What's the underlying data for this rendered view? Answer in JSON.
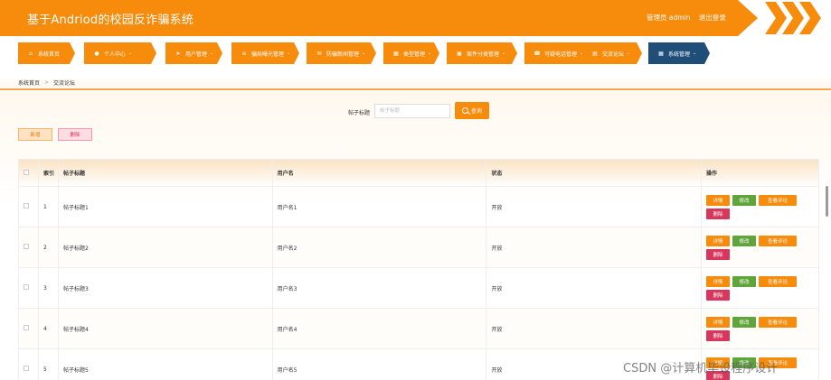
{
  "header": {
    "title": "基于Andriod的校园反诈骗系统",
    "role_label": "管理员 admin",
    "logout_label": "退出登录",
    "color": "#f78b0b"
  },
  "nav": {
    "items": [
      {
        "label": "系统首页",
        "icon": "home-icon",
        "glyph": "⌂",
        "caret": ""
      },
      {
        "label": "个人中心",
        "icon": "user-icon",
        "glyph": "●",
        "caret": "⌄"
      },
      {
        "label": "用户管理",
        "icon": "send-icon",
        "glyph": "➤",
        "caret": "⌄"
      },
      {
        "label": "骗局曝光管理",
        "icon": "document-icon",
        "glyph": "≡",
        "caret": "⌄"
      },
      {
        "label": "防骗新闻管理",
        "icon": "mail-icon",
        "glyph": "✉",
        "caret": "⌄"
      },
      {
        "label": "类型管理",
        "icon": "grid-icon",
        "glyph": "▦",
        "caret": "⌄"
      },
      {
        "label": "案件分类管理",
        "icon": "folder-icon",
        "glyph": "▣",
        "caret": "⌄"
      },
      {
        "label": "可疑电话管理",
        "icon": "comment-icon",
        "glyph": "☎",
        "caret": "⌄"
      },
      {
        "label": "交流论坛",
        "icon": "chat-icon",
        "glyph": "▤",
        "caret": "⌄"
      },
      {
        "label": "系统管理",
        "icon": "grid-icon",
        "glyph": "▦",
        "caret": "⌄"
      }
    ],
    "active_index": 9,
    "active_color": "#1f4e79"
  },
  "breadcrumb": {
    "home": "系统首页",
    "current": "交流论坛",
    "separator": ">"
  },
  "search": {
    "label": "帖子标题",
    "placeholder": "帖子标题",
    "value": "",
    "button_label": "查询"
  },
  "actions": {
    "add_label": "新增",
    "delete_label": "删除"
  },
  "table": {
    "headers": {
      "index": "索引",
      "title": "帖子标题",
      "username": "用户名",
      "status": "状态",
      "ops": "操作"
    },
    "rows": [
      {
        "index": "1",
        "title": "帖子标题1",
        "username": "用户名1",
        "status": "开放"
      },
      {
        "index": "2",
        "title": "帖子标题2",
        "username": "用户名2",
        "status": "开放"
      },
      {
        "index": "3",
        "title": "帖子标题3",
        "username": "用户名3",
        "status": "开放"
      },
      {
        "index": "4",
        "title": "帖子标题4",
        "username": "用户名4",
        "status": "开放"
      },
      {
        "index": "5",
        "title": "帖子标题5",
        "username": "用户名5",
        "status": "开放"
      }
    ],
    "op_labels": {
      "detail": "详情",
      "edit": "修改",
      "comments": "查看评论",
      "delete": "删除"
    }
  },
  "watermark": "CSDN @计算机毕设程序设计"
}
